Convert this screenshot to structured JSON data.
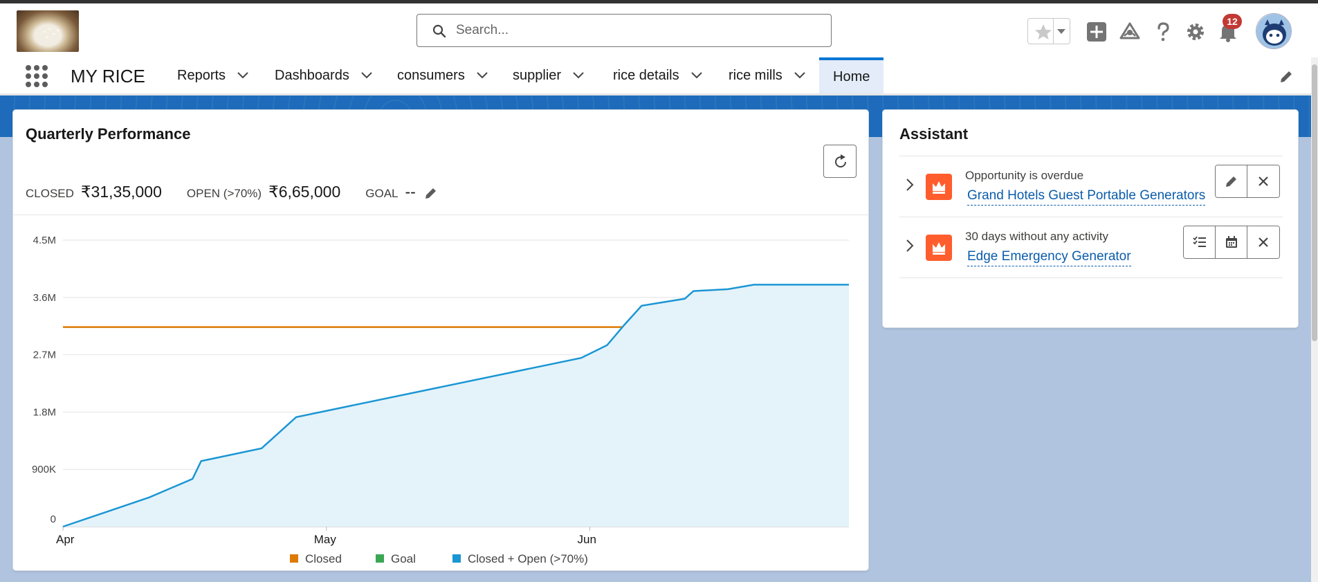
{
  "header": {
    "search_placeholder": "Search...",
    "notification_count": "12",
    "icons": [
      "search-icon",
      "favorites-star-icon",
      "add-icon",
      "trailhead-icon",
      "help-icon",
      "setup-gear-icon",
      "notifications-bell-icon",
      "avatar"
    ]
  },
  "nav": {
    "app_name": "MY RICE",
    "tabs": [
      {
        "label": "Reports",
        "has_menu": true
      },
      {
        "label": "Dashboards",
        "has_menu": true
      },
      {
        "label": "consumers",
        "has_menu": true
      },
      {
        "label": "supplier",
        "has_menu": true
      },
      {
        "label": "rice details",
        "has_menu": true
      },
      {
        "label": "rice mills",
        "has_menu": true
      },
      {
        "label": "Home",
        "has_menu": false,
        "active": true
      }
    ]
  },
  "performance": {
    "title": "Quarterly Performance",
    "closed_label": "CLOSED",
    "closed_value": "₹31,35,000",
    "open_label": "OPEN (>70%)",
    "open_value": "₹6,65,000",
    "goal_label": "GOAL",
    "goal_value": "--"
  },
  "chart_data": {
    "type": "area",
    "x_ticks": [
      "Apr",
      "May",
      "Jun"
    ],
    "y_ticks": [
      "0",
      "900K",
      "1.8M",
      "2.7M",
      "3.6M",
      "4.5M"
    ],
    "ylim": [
      0,
      4500000
    ],
    "xlim": [
      0,
      91
    ],
    "series": [
      {
        "name": "Closed",
        "color": "#dd7a01",
        "type": "line",
        "x": [
          0,
          91
        ],
        "y": [
          3135000,
          3135000
        ]
      },
      {
        "name": "Goal",
        "color": "#3ba755",
        "type": "line",
        "x": [],
        "y": []
      },
      {
        "name": "Closed + Open (>70%)",
        "color": "#1b96d4",
        "type": "area",
        "x": [
          0,
          10,
          15,
          16,
          23,
          27,
          60,
          63,
          65,
          67,
          72,
          73,
          77,
          80,
          91
        ],
        "y": [
          0,
          460000,
          750000,
          1030000,
          1230000,
          1720000,
          2650000,
          2850000,
          3170000,
          3470000,
          3580000,
          3700000,
          3730000,
          3800000,
          3800000
        ]
      }
    ],
    "legend": [
      "Closed",
      "Goal",
      "Closed + Open (>70%)"
    ],
    "legend_position": "bottom",
    "grid": true
  },
  "assistant": {
    "title": "Assistant",
    "items": [
      {
        "subtitle": "Opportunity is overdue",
        "link": "Grand Hotels Guest Portable Generators",
        "actions": [
          "edit-icon",
          "dismiss-icon"
        ]
      },
      {
        "subtitle": "30 days without any activity",
        "link": "Edge Emergency Generator",
        "actions": [
          "new-task-icon",
          "new-event-icon",
          "dismiss-icon"
        ]
      }
    ]
  }
}
